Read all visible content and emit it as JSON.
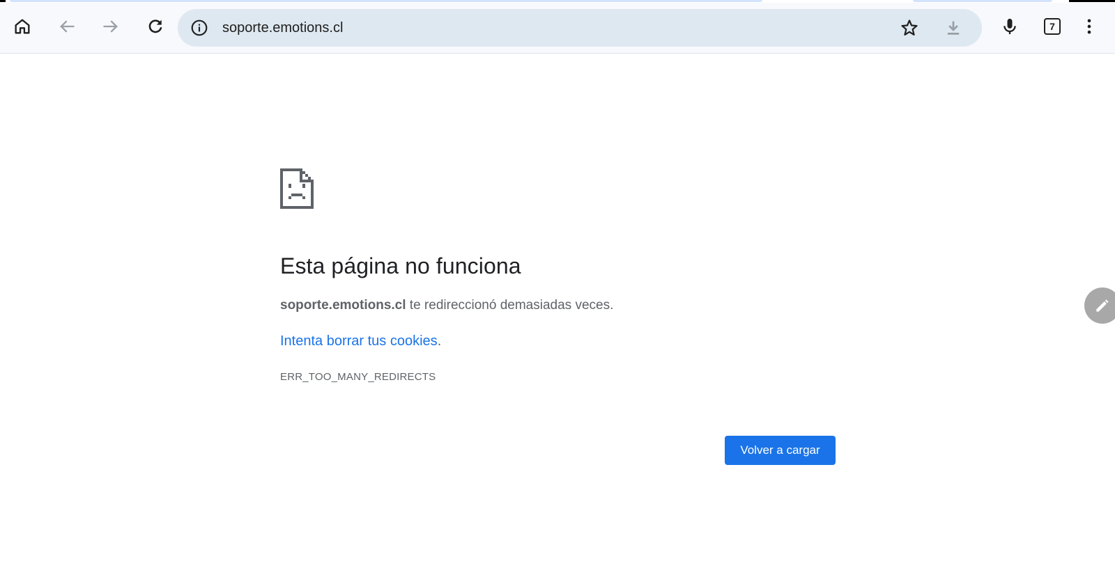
{
  "browser": {
    "url": "soporte.emotions.cl",
    "tab_count": "7",
    "icons": {
      "home": "home-icon",
      "back": "arrow-back-icon",
      "forward": "arrow-forward-icon",
      "reload": "reload-icon",
      "info": "info-icon",
      "bookmark": "star-icon",
      "download": "download-icon",
      "voice": "microphone-icon",
      "menu": "more-vert-icon"
    }
  },
  "error_page": {
    "title": "Esta página no funciona",
    "host": "soporte.emotions.cl",
    "message": " te redireccionó demasiadas veces.",
    "suggestion_link": "Intenta borrar tus cookies",
    "suggestion_suffix": ".",
    "error_code": "ERR_TOO_MANY_REDIRECTS",
    "reload_button": "Volver a cargar"
  },
  "colors": {
    "accent": "#1a73e8",
    "toolbar_bg": "#f8f9fd",
    "omnibox_bg": "#dee8f0",
    "text_secondary": "#5f6368"
  }
}
